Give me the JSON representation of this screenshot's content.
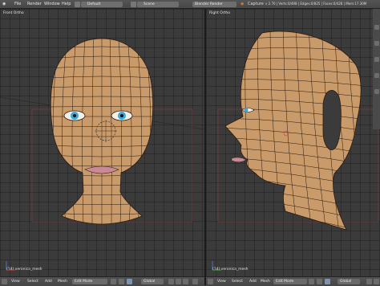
{
  "menu": {
    "file": "File",
    "render": "Render",
    "window": "Window",
    "help": "Help"
  },
  "layout_field": "Default",
  "scene_field": "Scene",
  "engine": "Blender Render",
  "stats": "v 2.70 | Verts:0/498 | Edges:0/825 | Faces:0/428 | Mem:17.30M",
  "stats_short": "Capture",
  "left_view": {
    "label": "Front Ortho",
    "object": "(14) veronica_mesh"
  },
  "right_view": {
    "label": "Right Ortho",
    "object": "(14) veronica_mesh"
  },
  "footer": {
    "view": "View",
    "select": "Select",
    "add": "Add",
    "mesh": "Mesh",
    "mode": "Edit Mode",
    "orientation": "Global"
  },
  "colors": {
    "skin": "#c99a6a",
    "wire": "#2a1a0f",
    "eye": "#3aa8d8",
    "lips": "#c98a98"
  }
}
